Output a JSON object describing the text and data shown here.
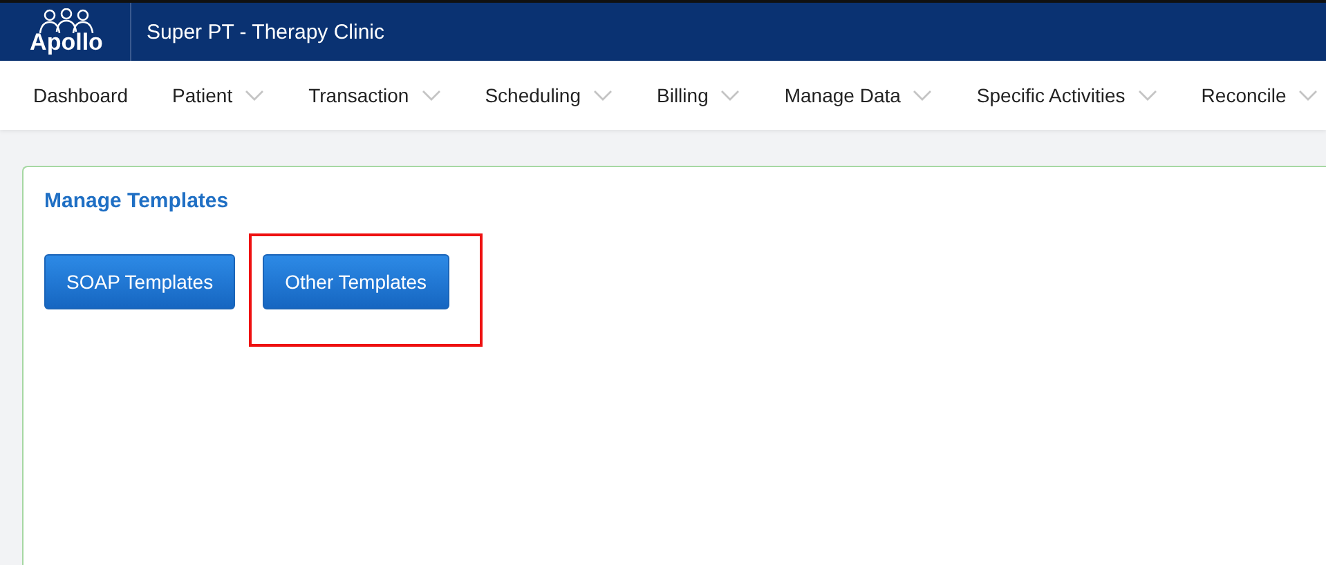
{
  "header": {
    "logo_text": "Apollo",
    "title": "Super PT - Therapy Clinic"
  },
  "nav": [
    {
      "label": "Dashboard",
      "dropdown": false
    },
    {
      "label": "Patient",
      "dropdown": true
    },
    {
      "label": "Transaction",
      "dropdown": true
    },
    {
      "label": "Scheduling",
      "dropdown": true
    },
    {
      "label": "Billing",
      "dropdown": true
    },
    {
      "label": "Manage Data",
      "dropdown": true
    },
    {
      "label": "Specific Activities",
      "dropdown": true
    },
    {
      "label": "Reconcile",
      "dropdown": true
    }
  ],
  "panel": {
    "title": "Manage Templates",
    "buttons": [
      {
        "label": "SOAP Templates",
        "highlighted": false
      },
      {
        "label": "Other Templates",
        "highlighted": true
      }
    ]
  }
}
